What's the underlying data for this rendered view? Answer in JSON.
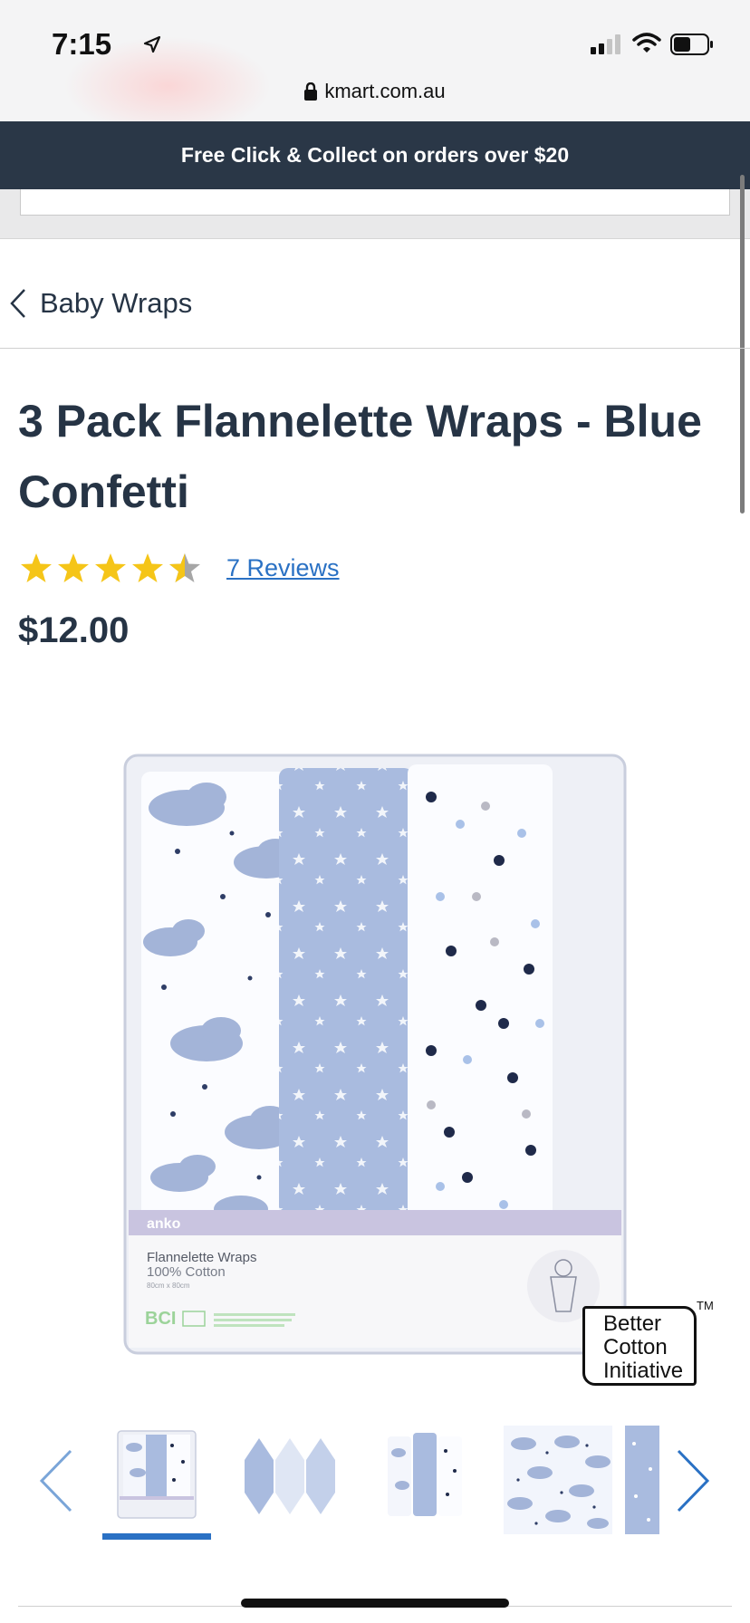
{
  "status_bar": {
    "time": "7:15",
    "url": "kmart.com.au"
  },
  "promo_banner": {
    "text": "Free Click & Collect on orders over $20"
  },
  "breadcrumb": {
    "label": "Baby Wraps"
  },
  "product": {
    "title": "3 Pack Flannelette Wraps - Blue Confetti",
    "rating": 4.5,
    "rating_max": 5,
    "reviews_label": "7 Reviews",
    "price": "$12.00"
  },
  "product_image": {
    "brand": "anko",
    "package_name": "Flannelette Wraps",
    "package_material": "100% Cotton",
    "package_size": "80cm x 80cm"
  },
  "badge": {
    "lines": [
      "Better",
      "Cotton",
      "Initiative"
    ],
    "tm": "TM"
  },
  "carousel": {
    "selected_index": 0,
    "thumbnail_count": 5
  },
  "colors": {
    "navy": "#2a3747",
    "link_blue": "#2a71c4",
    "star_gold": "#f5c518",
    "wrap_blue": "#a9bbdf"
  }
}
